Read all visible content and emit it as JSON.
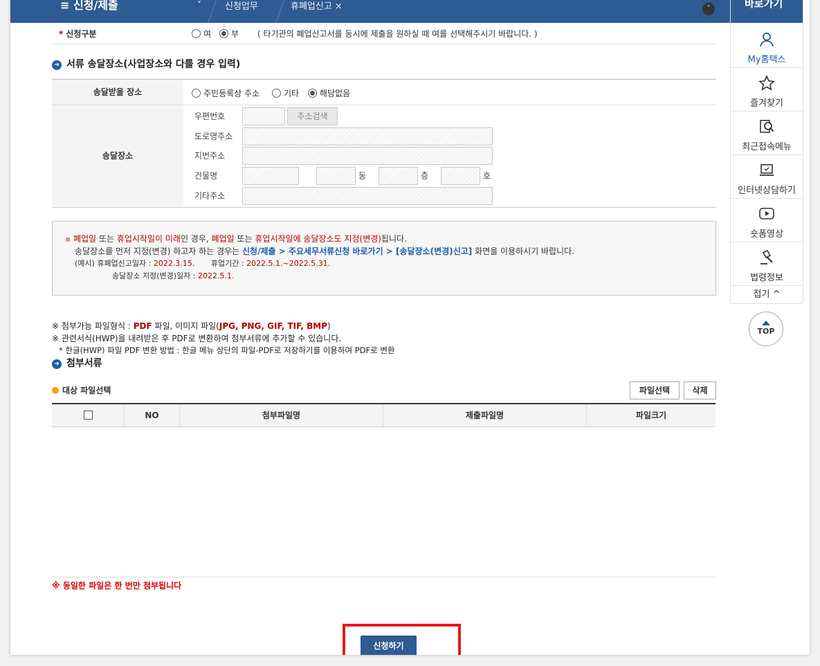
{
  "topbar": {
    "menu_title": "≡  신청/제출",
    "crumb1": "신청업무",
    "crumb2": "휴폐업신고  ×",
    "shortcut": "바로가기"
  },
  "apply_type": {
    "label": "신청구분",
    "opt_yes": "여",
    "opt_no": "부",
    "note": "( 타기관의 폐업신고서를 동시에 제출을 원하실 때 여를 선택해주시기 바랍니다. )"
  },
  "delivery": {
    "section_title": "서류 송달장소(사업장소와 다를 경우 입력)",
    "place_label": "송달받을 장소",
    "opt_resident": "주민등록상 주소",
    "opt_other": "기타",
    "opt_none": "해당없음",
    "addr_label": "송달장소",
    "zip_label": "우편번호",
    "search_btn": "주소검색",
    "road_label": "도로명주소",
    "lot_label": "지번주소",
    "bldg_label": "건물명",
    "dong": "동",
    "floor": "층",
    "ho": "호",
    "etc_label": "기타주소"
  },
  "notice": {
    "l1a": "폐업일",
    "l1b": " 또는 ",
    "l1c": "휴업시작일이 미래",
    "l1d": "인 경우, ",
    "l1e": "폐업일",
    "l1f": " 또는 ",
    "l1g": "휴업시작일에 송달장소도 지정(변경)",
    "l1h": "됩니다.",
    "l2a": "송달장소를 먼저 지정(변경) 하고자 하는 경우는 ",
    "l2b": "신청/제출 > 주요세무서류신청 바로가기 > [송달장소(변경)신고]",
    "l2c": " 화면을 이용하시기 바랍니다.",
    "l3a": "(예시) 휴폐업신고일자 : ",
    "l3b": "2022.3.15.",
    "l3c": "휴업기간 : ",
    "l3d": "2022.5.1.~2022.5.31.",
    "l4a": "송달장소 지정(변경)일자 : ",
    "l4b": "2022.5.1."
  },
  "attach_info": {
    "i1a": "※ 첨부가능 파일형식 : ",
    "i1b": "PDF",
    "i1c": " 파일, 이미지 파일(",
    "i1d": "JPG, PNG, GIF, TIF, BMP",
    "i1e": ")",
    "i2": "※ 관련서식(HWP)을 내려받은 후 PDF로 변환하여 첨부서류에 추가할 수 있습니다.",
    "i3": "* 한글(HWP) 파일 PDF 변환 방법 : 한글 메뉴 상단의 파일-PDF로 저장하기를 이용하여 PDF로 변환"
  },
  "attach": {
    "section_title": "첨부서류",
    "sub_title": "대상 파일선택",
    "select_btn": "파일선택",
    "delete_btn": "삭제",
    "col_no": "NO",
    "col_attach": "첨부파일명",
    "col_submit": "제출파일명",
    "col_size": "파일크기",
    "warning": "※ 동일한 파일은 한 번만 첨부됩니다"
  },
  "submit_label": "신청하기",
  "right_panel": {
    "my": "My홈택스",
    "fav": "즐겨찾기",
    "recent": "최근접속메뉴",
    "chat": "인터넷상담하기",
    "video": "숏폼영상",
    "law": "법령정보",
    "fold": "접기 ^",
    "top": "TOP"
  },
  "colors": {
    "accent": "#2e5b93",
    "highlight": "#e8191c",
    "emphasis_red": "#b30000"
  }
}
